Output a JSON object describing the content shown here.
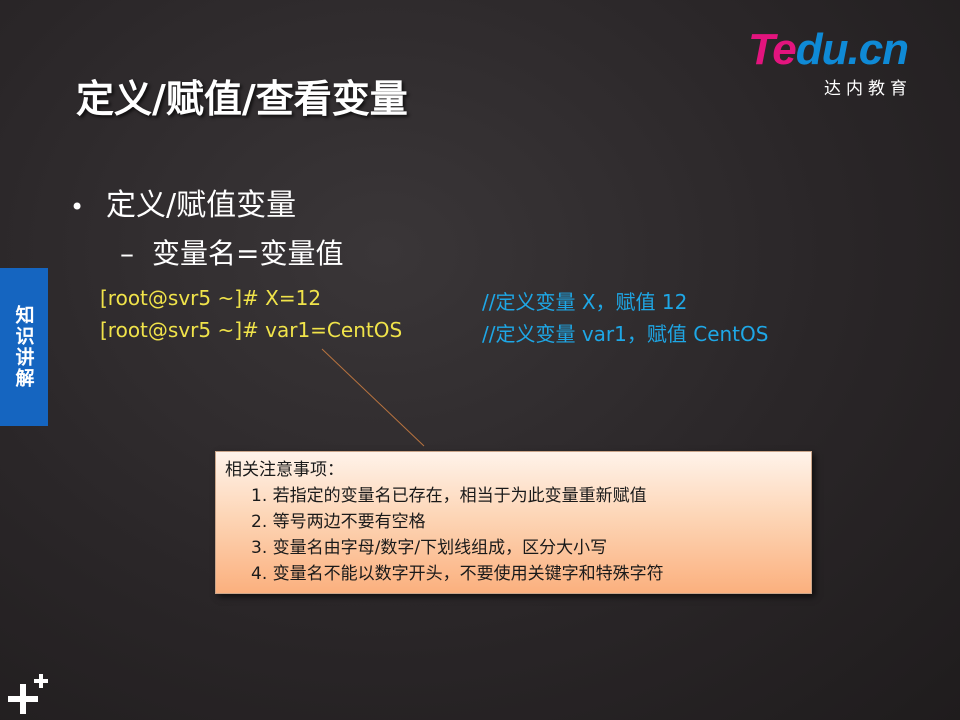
{
  "logo": {
    "part1": "Te",
    "part2": "du.cn",
    "subtitle": "达内教育"
  },
  "title": "定义/赋值/查看变量",
  "bullet_level1": "定义/赋值变量",
  "bullet_level2": "变量名=变量值",
  "side_tab": "知识讲解",
  "code_lines": [
    {
      "command": "[root@svr5 ~]# X=12",
      "comment": "//定义变量 X，赋值 12"
    },
    {
      "command": "[root@svr5 ~]# var1=CentOS",
      "comment": "//定义变量 var1，赋值 CentOS"
    }
  ],
  "note": {
    "heading": "相关注意事项：",
    "items": [
      "1. 若指定的变量名已存在，相当于为此变量重新赋值",
      "2. 等号两边不要有空格",
      "3. 变量名由字母/数字/下划线组成，区分大小写",
      "4. 变量名不能以数字开头，不要使用关键字和特殊字符"
    ]
  },
  "colors": {
    "command": "#f0e34a",
    "comment": "#1ea7e6",
    "side_tab": "#1565c0",
    "logo_pink": "#e3147e",
    "logo_blue": "#0f8ad6"
  },
  "icons": {
    "corner": "plus-logo-icon",
    "bullet": "bullet-dot-icon"
  }
}
